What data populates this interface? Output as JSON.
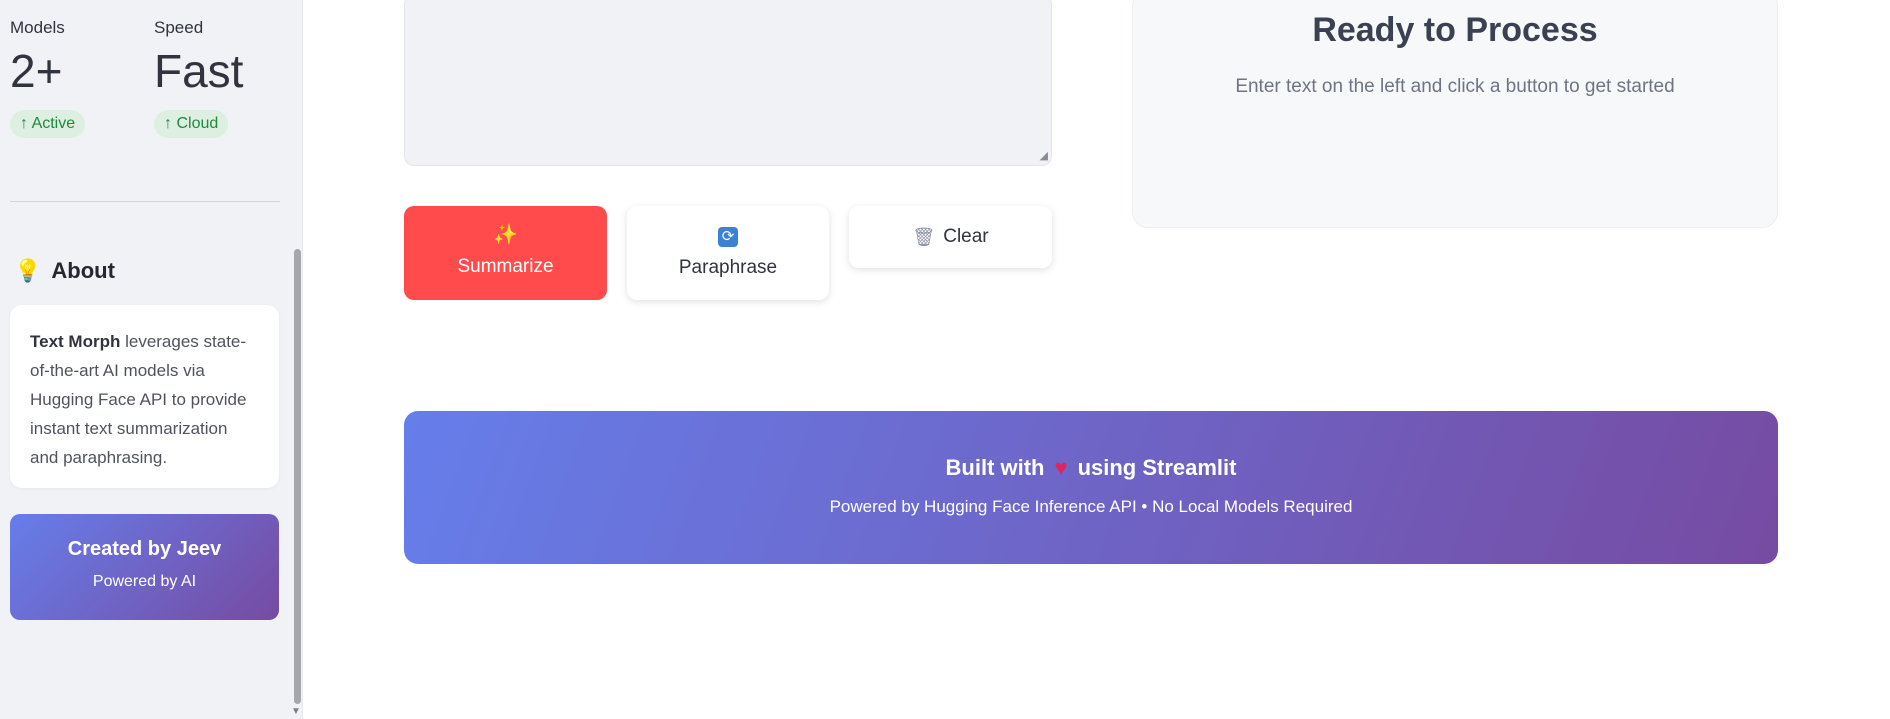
{
  "sidebar": {
    "metrics": [
      {
        "label": "Models",
        "value": "2+",
        "delta": "Active"
      },
      {
        "label": "Speed",
        "value": "Fast",
        "delta": "Cloud"
      }
    ],
    "about": {
      "title": "About",
      "brand": "Text Morph",
      "text": " leverages state-of-the-art AI models via Hugging Face API to provide instant text summarization and paraphrasing."
    },
    "creator": {
      "title": "Created by Jeev",
      "subtitle": "Powered by AI"
    }
  },
  "actions": {
    "summarize": "Summarize",
    "paraphrase": "Paraphrase",
    "clear": "Clear"
  },
  "status": {
    "title": "Ready to Process",
    "subtitle": "Enter text on the left and click a button to get started"
  },
  "footer": {
    "built_prefix": "Built with",
    "built_suffix": "using Streamlit",
    "powered": "Powered by Hugging Face Inference API • No Local Models Required"
  },
  "colors": {
    "primary": "#ff4b4b",
    "gradient_start": "#667eea",
    "gradient_end": "#764ba2",
    "success": "#1f8a3b"
  }
}
